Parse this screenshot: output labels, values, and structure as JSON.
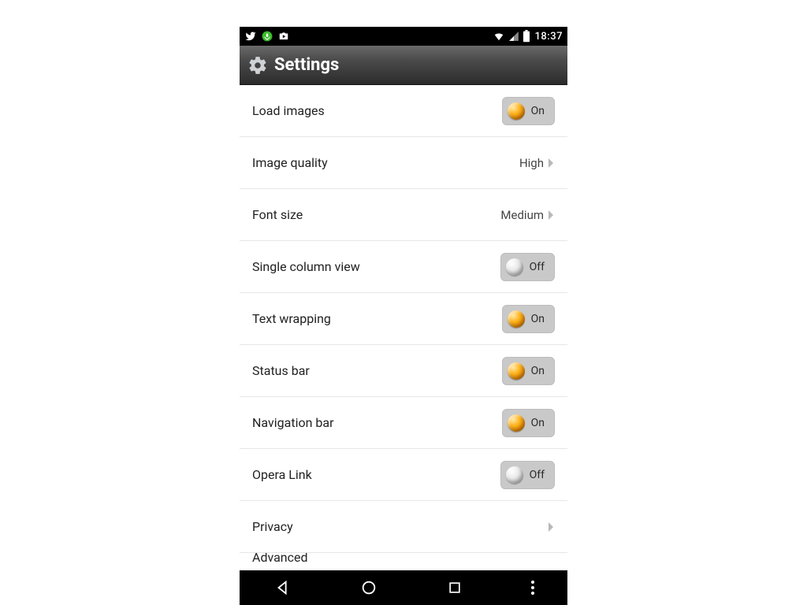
{
  "statusbar": {
    "time": "18:37"
  },
  "appbar": {
    "title": "Settings"
  },
  "toggle_labels": {
    "on": "On",
    "off": "Off"
  },
  "rows": {
    "load_images": {
      "label": "Load images",
      "type": "toggle",
      "state": "on"
    },
    "image_quality": {
      "label": "Image quality",
      "type": "value",
      "value": "High"
    },
    "font_size": {
      "label": "Font size",
      "type": "value",
      "value": "Medium"
    },
    "single_column": {
      "label": "Single column view",
      "type": "toggle",
      "state": "off"
    },
    "text_wrapping": {
      "label": "Text wrapping",
      "type": "toggle",
      "state": "on"
    },
    "status_bar": {
      "label": "Status bar",
      "type": "toggle",
      "state": "on"
    },
    "navigation_bar": {
      "label": "Navigation bar",
      "type": "toggle",
      "state": "on"
    },
    "opera_link": {
      "label": "Opera Link",
      "type": "toggle",
      "state": "off"
    },
    "privacy": {
      "label": "Privacy",
      "type": "nav"
    },
    "advanced": {
      "label": "Advanced",
      "type": "nav"
    }
  }
}
